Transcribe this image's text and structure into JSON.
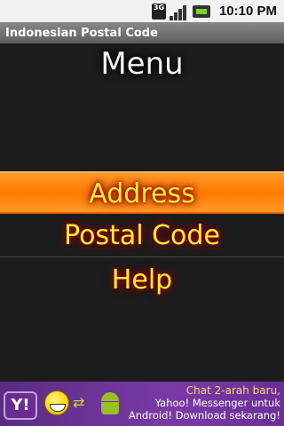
{
  "status_bar": {
    "network": "3G",
    "time": "10:10 PM",
    "icons": [
      "3g-icon",
      "signal-icon",
      "battery-icon"
    ]
  },
  "app": {
    "title": "Indonesian Postal Code"
  },
  "menu": {
    "heading": "Menu",
    "items": [
      {
        "label": "Address",
        "selected": true
      },
      {
        "label": "Postal Code",
        "selected": false
      },
      {
        "label": "Help",
        "selected": false
      }
    ]
  },
  "ad": {
    "logo_text": "Y!",
    "line1": "Chat 2-arah baru,",
    "line2": "Yahoo! Messenger untuk",
    "line3": "Android! Download sekarang!",
    "icons": [
      "yahoo-logo-icon",
      "smiley-icon",
      "arrows-icon",
      "android-icon"
    ]
  },
  "colors": {
    "selected_bg": "#ff8000",
    "item_text": "#ffef2e",
    "background": "#1c1c1c",
    "ad_bg": "#6b2f96"
  }
}
